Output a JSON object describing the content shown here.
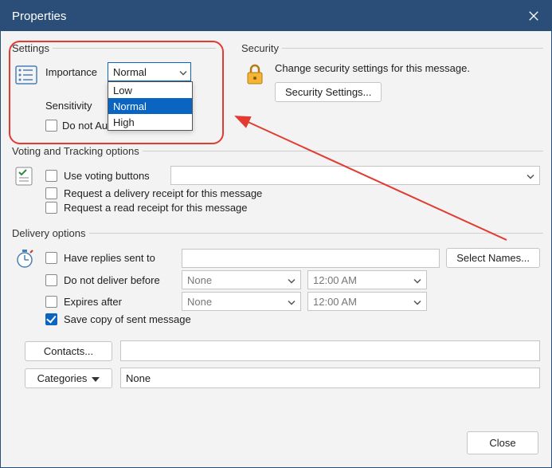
{
  "titlebar": {
    "title": "Properties"
  },
  "settings": {
    "legend": "Settings",
    "importance_label": "Importance",
    "importance_value": "Normal",
    "importance_options": {
      "low": "Low",
      "normal": "Normal",
      "high": "High"
    },
    "sensitivity_label": "Sensitivity",
    "autoarchive_label": "Do not AutoArchive this item"
  },
  "security": {
    "legend": "Security",
    "text": "Change security settings for this message.",
    "button": "Security Settings..."
  },
  "voting": {
    "legend": "Voting and Tracking options",
    "use_voting": "Use voting buttons",
    "delivery_receipt": "Request a delivery receipt for this message",
    "read_receipt": "Request a read receipt for this message"
  },
  "delivery": {
    "legend": "Delivery options",
    "have_replies": "Have replies sent to",
    "select_names": "Select Names...",
    "not_before": "Do not deliver before",
    "expires_after": "Expires after",
    "save_copy": "Save copy of sent message",
    "date_none": "None",
    "time_default": "12:00 AM"
  },
  "bottom": {
    "contacts": "Contacts...",
    "categories": "Categories",
    "categories_value": "None"
  },
  "footer": {
    "close": "Close"
  }
}
